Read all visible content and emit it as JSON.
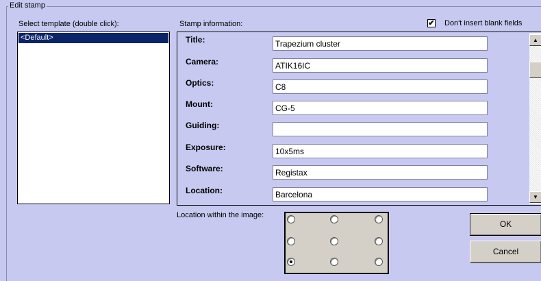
{
  "group": {
    "title": "Edit stamp"
  },
  "templates": {
    "label": "Select template (double click):",
    "items": [
      "<Default>"
    ]
  },
  "stamp": {
    "label": "Stamp information:",
    "dont_insert_blank_label": "Don't insert blank fields",
    "dont_insert_blank_checked": true,
    "fields": [
      {
        "label": "Title:",
        "value": "Trapezium cluster"
      },
      {
        "label": "Camera:",
        "value": "ATIK16IC"
      },
      {
        "label": "Optics:",
        "value": "C8"
      },
      {
        "label": "Mount:",
        "value": "CG-5"
      },
      {
        "label": "Guiding:",
        "value": ""
      },
      {
        "label": "Exposure:",
        "value": "10x5ms"
      },
      {
        "label": "Software:",
        "value": "Registax"
      },
      {
        "label": "Location:",
        "value": "Barcelona"
      }
    ]
  },
  "location": {
    "label": "Location within the image:",
    "selected": "bottom-left"
  },
  "buttons": {
    "ok": "OK",
    "cancel": "Cancel"
  },
  "icons": {
    "scroll_up": "scroll-up-arrow-icon",
    "scroll_down": "scroll-down-arrow-icon",
    "check": "checkmark-icon"
  }
}
